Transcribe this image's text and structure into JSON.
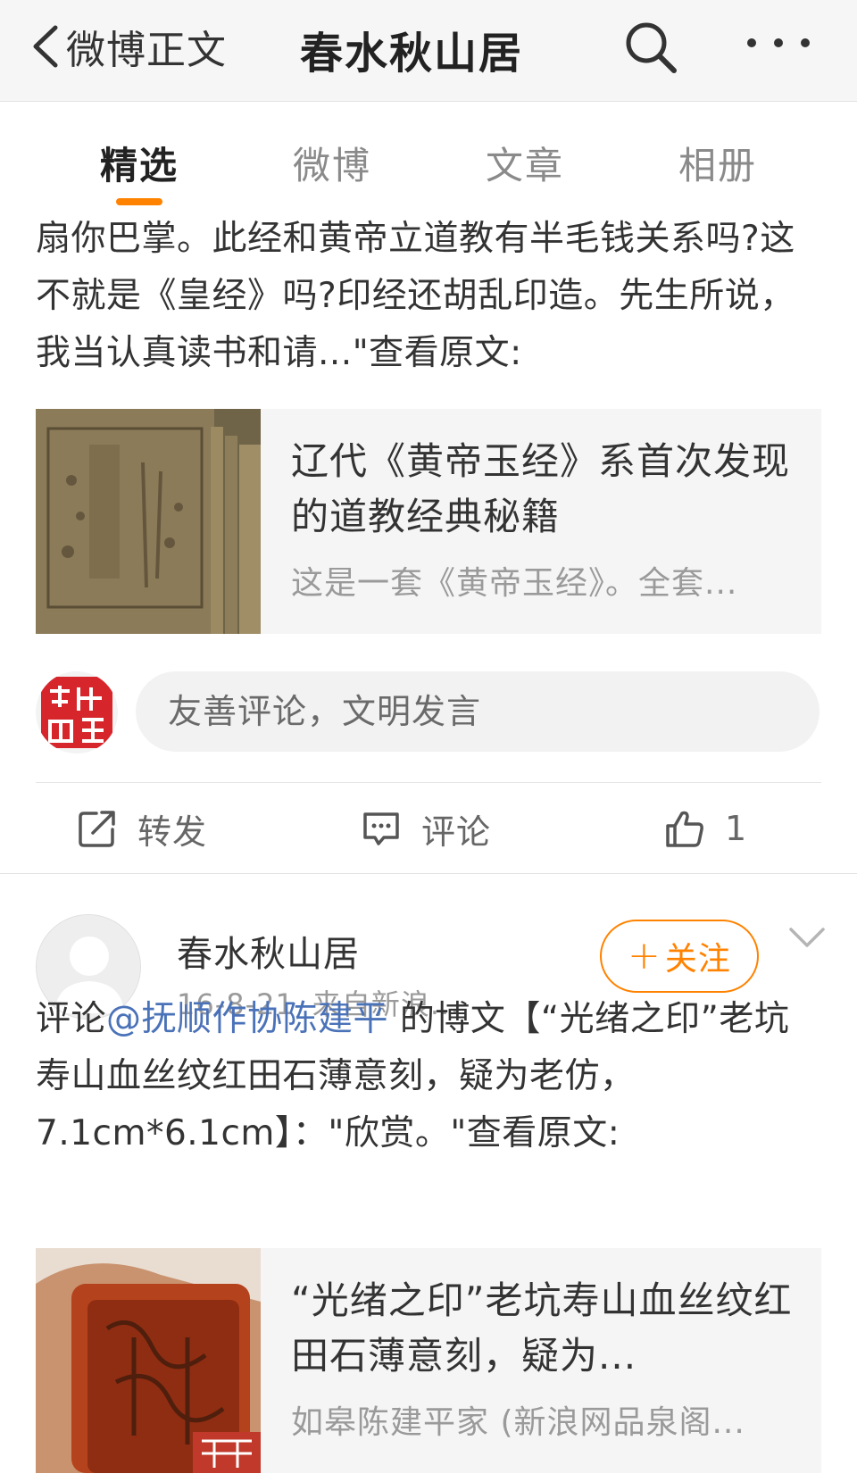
{
  "header": {
    "back_label": "微博正文",
    "title": "春水秋山居"
  },
  "tabs": [
    {
      "label": "精选",
      "active": true
    },
    {
      "label": "微博",
      "active": false
    },
    {
      "label": "文章",
      "active": false
    },
    {
      "label": "相册",
      "active": false
    }
  ],
  "post1": {
    "text": "扇你巴掌。此经和黄帝立道教有半毛钱关系吗?这不就是《皇经》吗?印经还胡乱印造。先生所说，我当认真读书和请...\"查看原文:",
    "card": {
      "title": "辽代《黄帝玉经》系首次发现的道教经典秘籍",
      "desc": "这是一套《黄帝玉经》。全套..."
    },
    "comment_placeholder": "友善评论，文明发言",
    "actions": {
      "repost": "转发",
      "comment": "评论",
      "like_count": "1"
    }
  },
  "post2": {
    "username": "春水秋山居",
    "date": "16-8-21",
    "source": "来自新浪...",
    "follow_label": "关注",
    "follow_plus": "+",
    "text_prefix": "评论",
    "mention": "@抚顺作协陈建平",
    "text_suffix": " 的博文【“光绪之印”老坑寿山血丝纹红田石薄意刻，疑为老仿，7.1cm*6.1cm】：\"欣赏。\"查看原文:",
    "card": {
      "title": "“光绪之印”老坑寿山血丝纹红田石薄意刻，疑为...",
      "desc": "如皋陈建平家 (新浪网品泉阁..."
    }
  },
  "colors": {
    "accent": "#ff8200",
    "link": "#4a72b8",
    "header_bg": "#f6f6f6"
  }
}
